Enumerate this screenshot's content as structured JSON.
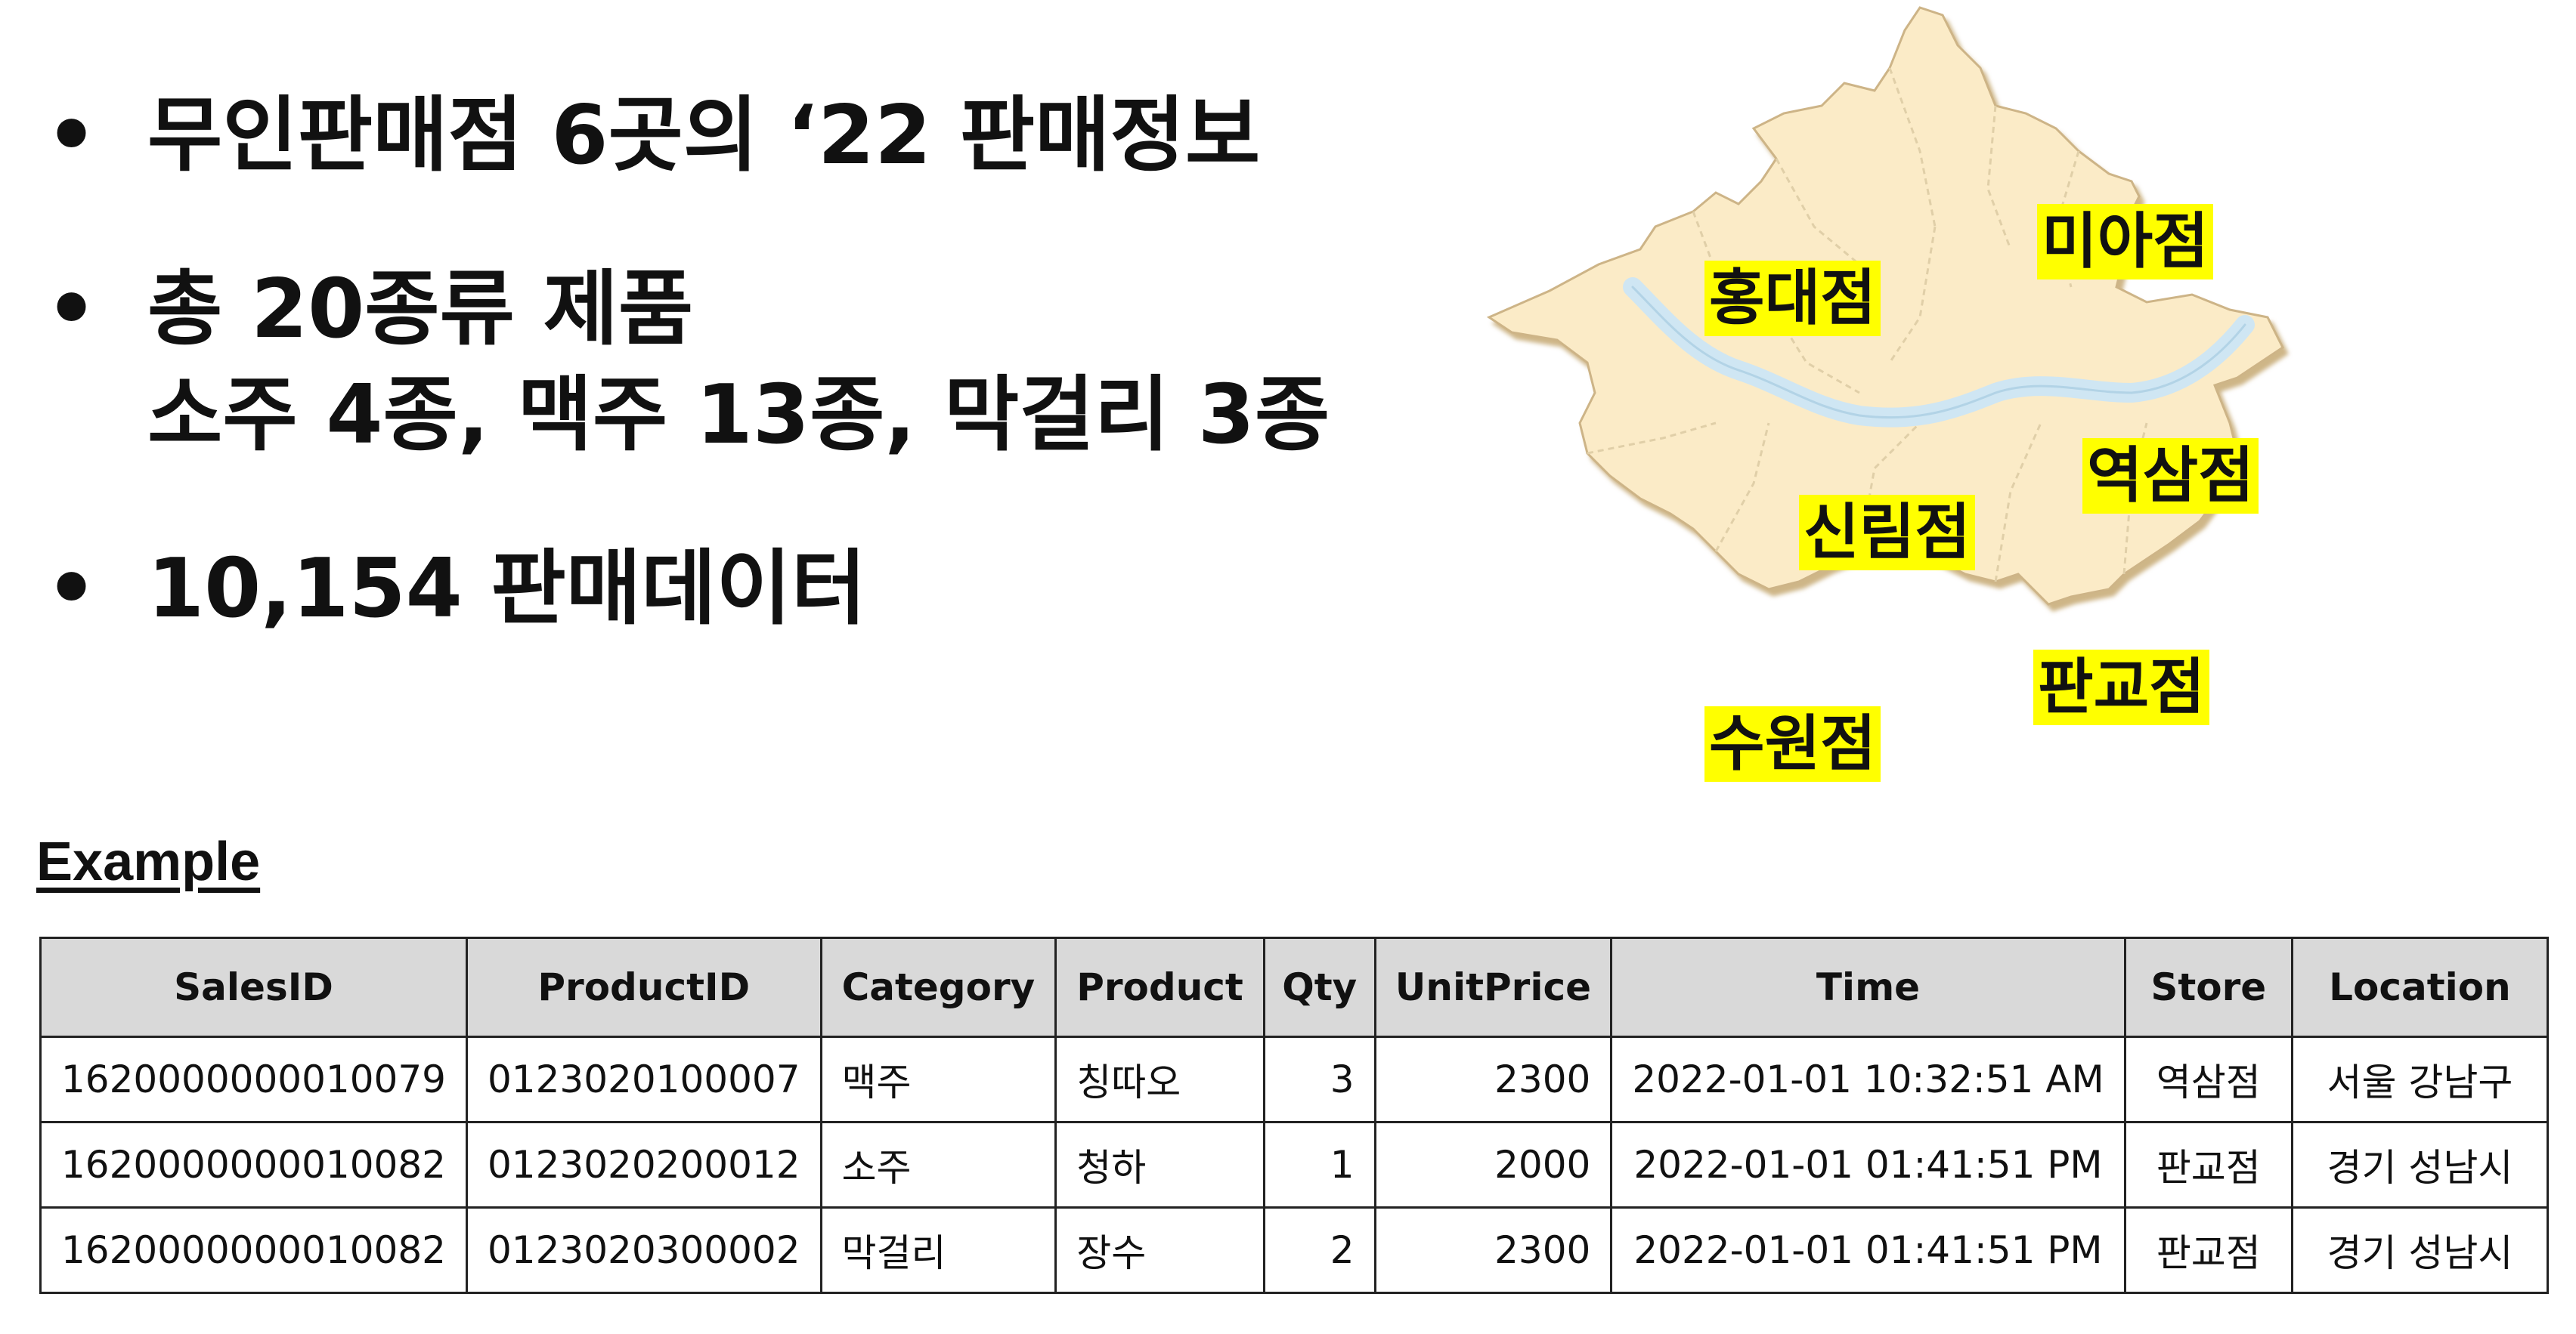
{
  "bullets": {
    "marker": "•",
    "line1": "무인판매점 6곳의 ‘22 판매정보",
    "line2a": "총 20종류 제품",
    "line2b": "소주 4종, 맥주 13종, 막걸리 3종",
    "line3": "10,154 판매데이터"
  },
  "map": {
    "fill_color": "#fbebc7",
    "edge_color": "#cdb487",
    "river_color": "#cfe6f3",
    "labels": {
      "hongdae": "홍대점",
      "mia": "미아점",
      "yeoksam": "역삼점",
      "sillim": "신림점",
      "pangyo": "판교점",
      "suwon": "수원점"
    },
    "label_highlight": "#ffff00"
  },
  "example_heading": "Example",
  "table": {
    "headers": [
      "SalesID",
      "ProductID",
      "Category",
      "Product",
      "Qty",
      "UnitPrice",
      "Time",
      "Store",
      "Location"
    ],
    "rows": [
      [
        "1620000000010079",
        "0123020100007",
        "맥주",
        "칭따오",
        "3",
        "2300",
        "2022-01-01 10:32:51 AM",
        "역삼점",
        "서울 강남구"
      ],
      [
        "1620000000010082",
        "0123020200012",
        "소주",
        "청하",
        "1",
        "2000",
        "2022-01-01 01:41:51 PM",
        "판교점",
        "경기 성남시"
      ],
      [
        "1620000000010082",
        "0123020300002",
        "막걸리",
        "장수",
        "2",
        "2300",
        "2022-01-01 01:41:51 PM",
        "판교점",
        "경기 성남시"
      ]
    ]
  }
}
